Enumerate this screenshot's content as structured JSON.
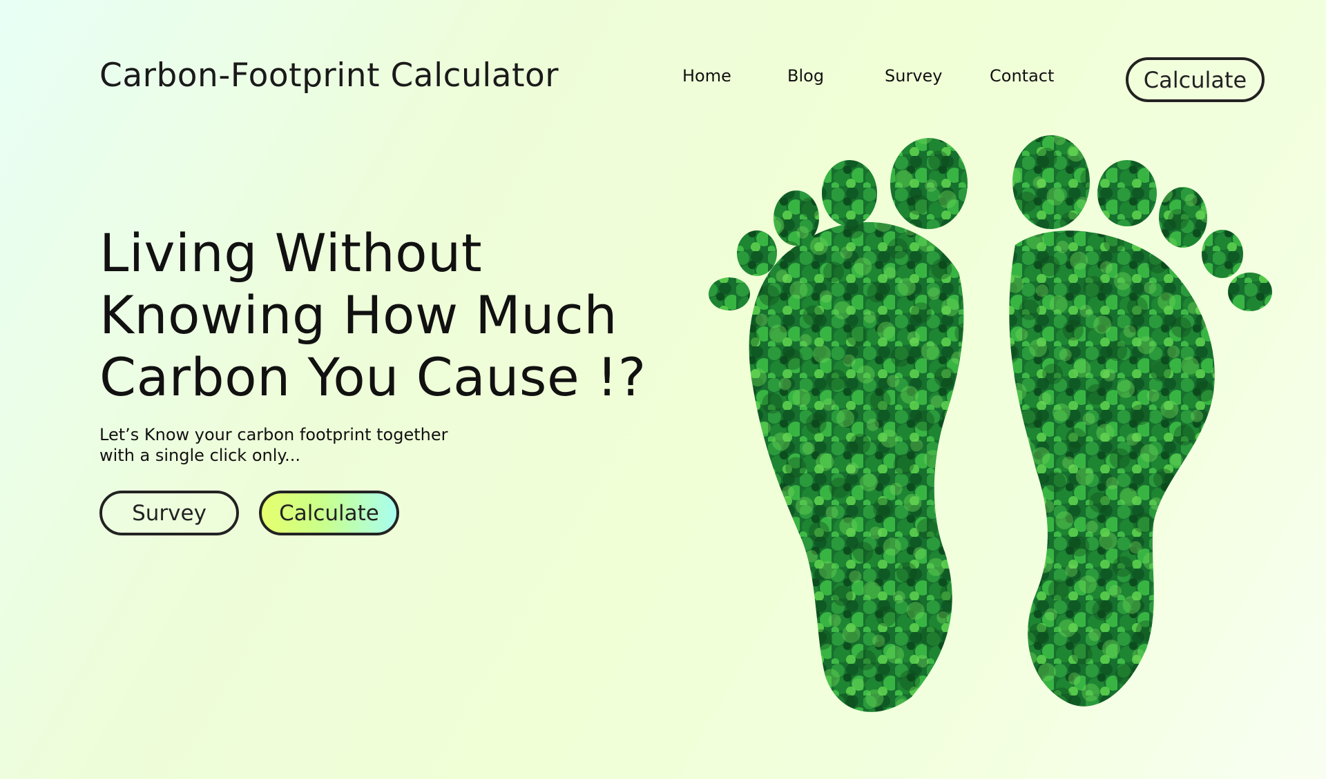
{
  "header": {
    "brand": "Carbon-Footprint Calculator",
    "nav": [
      {
        "label": "Home"
      },
      {
        "label": "Blog"
      },
      {
        "label": "Survey"
      },
      {
        "label": "Contact"
      }
    ],
    "cta_label": "Calculate"
  },
  "hero": {
    "headline_line1": "Living Without",
    "headline_line2": "Knowing How Much",
    "headline_line3": "Carbon You Cause !?",
    "subtitle_line1": "Let’s Know your carbon footprint together",
    "subtitle_line2": "with a single click only...",
    "survey_label": "Survey",
    "calculate_label": "Calculate"
  },
  "illustration": {
    "subject": "footprints-made-of-forest",
    "colors": {
      "dark": "#0f5a24",
      "mid": "#1f8a34",
      "light": "#4cc244"
    }
  }
}
